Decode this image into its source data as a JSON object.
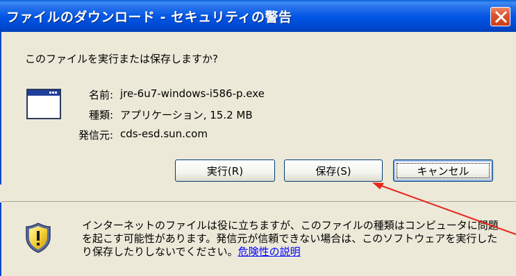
{
  "dialog": {
    "title": "ファイルのダウンロード - セキュリティの警告",
    "question": "このファイルを実行または保存しますか?",
    "file": {
      "name_label": "名前:",
      "name_value": "jre-6u7-windows-i586-p.exe",
      "type_label": "種類:",
      "type_value": "アプリケーション, 15.2 MB",
      "from_label": "発信元:",
      "from_value": "cds-esd.sun.com"
    },
    "buttons": {
      "run": "実行(R)",
      "save": "保存(S)",
      "cancel": "キャンセル"
    },
    "warning": {
      "text": "インターネットのファイルは役に立ちますが、このファイルの種類はコンピュータに問題を起こす可能性があります。発信元が信頼できない場合は、このソフトウェアを実行したり保存したりしないでください。",
      "link": "危険性の説明"
    }
  },
  "icons": {
    "close": "close-icon",
    "file": "application-window-icon",
    "shield": "security-shield-warning-icon"
  },
  "colors": {
    "titlebar": "#0055e5",
    "close_button": "#e0522c",
    "dialog_bg": "#ece9d8",
    "link": "#0000ff",
    "annotation_arrow": "#e8261c"
  }
}
